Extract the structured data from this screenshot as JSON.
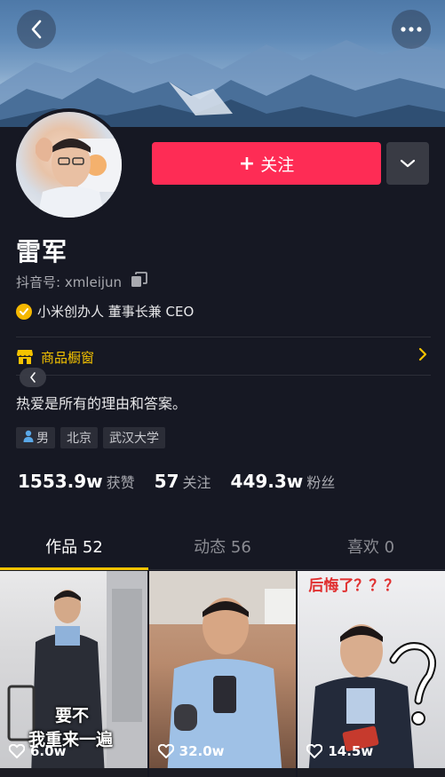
{
  "header": {
    "back_icon": "chevron-left-icon",
    "more_icon": "more-dots-icon"
  },
  "profile": {
    "follow_label": "关注",
    "name": "雷军",
    "douyin_id": "抖音号: xmleijun",
    "verification": "小米创办人 董事长兼 CEO",
    "shop_label": "商品橱窗",
    "bio": "热爱是所有的理由和答案。",
    "tags": [
      "男",
      "北京",
      "武汉大学"
    ]
  },
  "stats": [
    {
      "num": "1553.9w",
      "label": "获赞"
    },
    {
      "num": "57",
      "label": "关注"
    },
    {
      "num": "449.3w",
      "label": "粉丝"
    }
  ],
  "tabs": [
    {
      "label": "作品 52",
      "active": true
    },
    {
      "label": "动态 56",
      "active": false
    },
    {
      "label": "喜欢 0",
      "active": false
    }
  ],
  "videos": [
    {
      "likes": "6.0w",
      "caption_line1": "要不",
      "caption_line2": "我重来一遍"
    },
    {
      "likes": "32.0w"
    },
    {
      "likes": "14.5w",
      "top_caption": "后悔了？？？"
    }
  ],
  "colors": {
    "accent": "#fe2c55",
    "background": "#161823",
    "tab_indicator": "#f5c300",
    "verify_badge": "#f5b800"
  }
}
